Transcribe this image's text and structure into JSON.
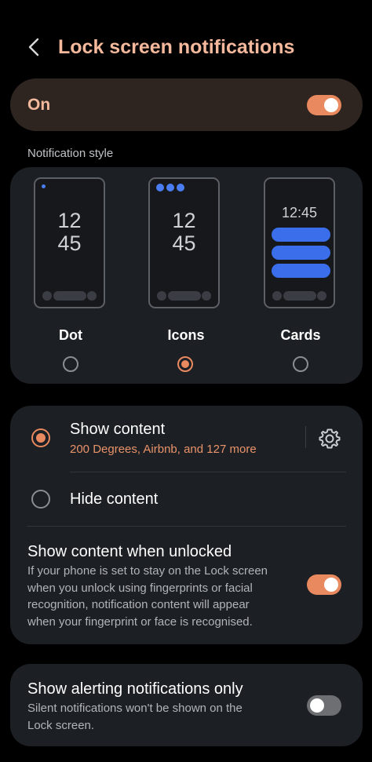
{
  "header": {
    "title": "Lock screen notifications",
    "back_icon": "back-arrow-icon"
  },
  "master_switch": {
    "label": "On",
    "on": true
  },
  "notification_style": {
    "section_label": "Notification style",
    "options": [
      {
        "label": "Dot",
        "selected": false,
        "preview_time": [
          "12",
          "45"
        ]
      },
      {
        "label": "Icons",
        "selected": true,
        "preview_time": [
          "12",
          "45"
        ]
      },
      {
        "label": "Cards",
        "selected": false,
        "preview_time": [
          "12:45"
        ]
      }
    ]
  },
  "content": {
    "show_content": {
      "title": "Show content",
      "subtitle": "200 Degrees, Airbnb, and 127 more",
      "selected": true,
      "settings_icon": "gear-icon"
    },
    "hide_content": {
      "title": "Hide content",
      "selected": false
    },
    "show_when_unlocked": {
      "title": "Show content when unlocked",
      "lines": [
        "If your phone is set to stay on the Lock screen",
        "when you unlock using fingerprints or facial",
        "recognition, notification content will appear",
        "when your fingerprint or face is recognised."
      ],
      "on": true
    }
  },
  "alerting": {
    "title": "Show alerting notifications only",
    "lines": [
      "Silent notifications won't be shown on the",
      "Lock screen."
    ],
    "on": false
  },
  "colors": {
    "accent": "#e8895f",
    "title": "#f4b89c",
    "card": "#1c1f23",
    "blue": "#3b6eea"
  }
}
